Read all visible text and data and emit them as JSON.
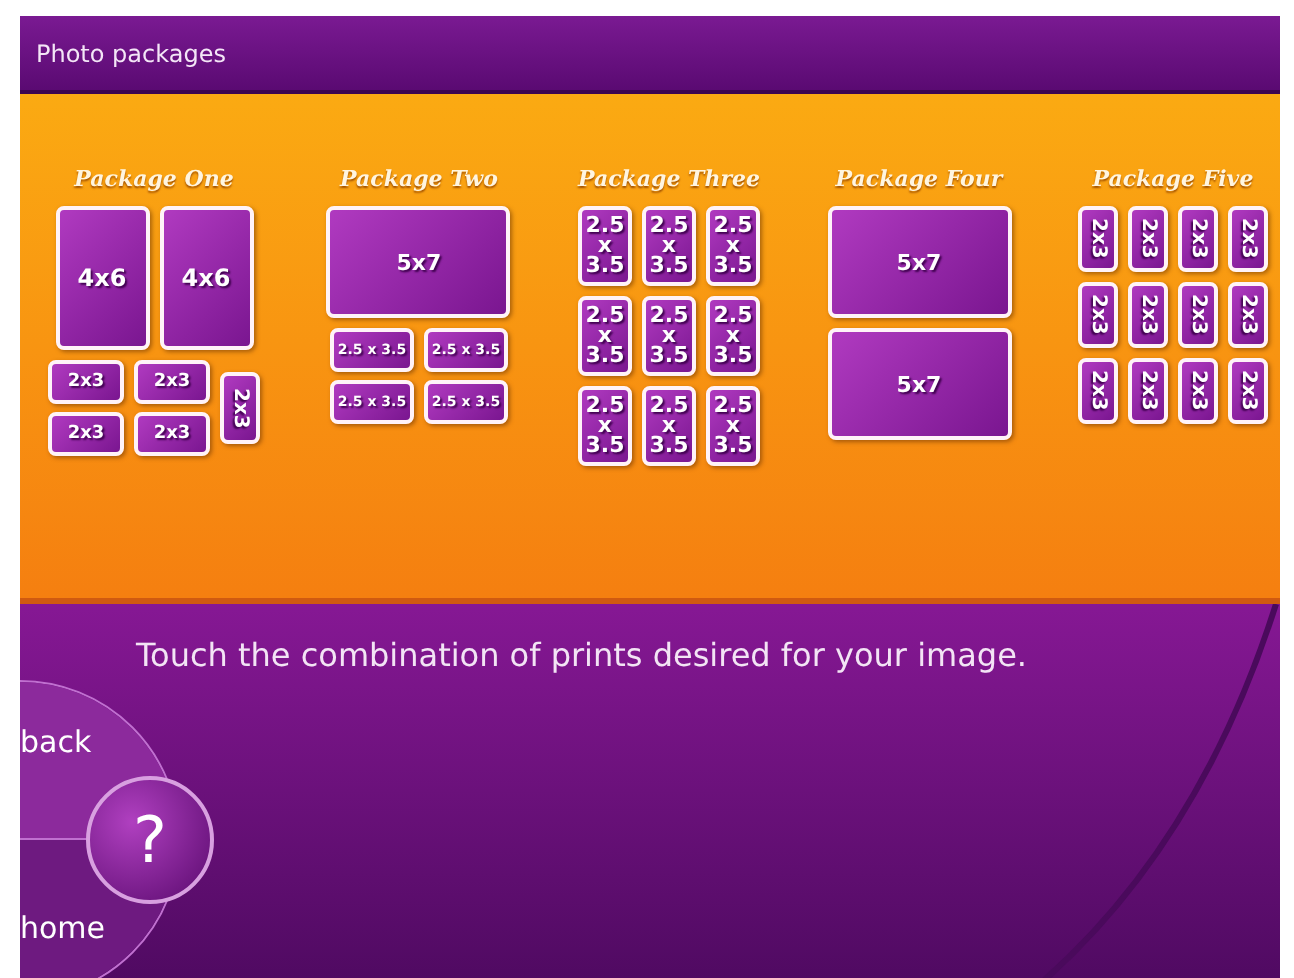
{
  "header": {
    "title": "Photo packages"
  },
  "packages": [
    {
      "title": "Package One",
      "rows": [
        {
          "kind": "line",
          "prints": [
            {
              "label": "4x6",
              "kind": "large-portrait"
            },
            {
              "label": "4x6",
              "kind": "large-portrait"
            }
          ]
        },
        {
          "kind": "pairs",
          "prints": [
            {
              "label": "2x3",
              "kind": "small-landscape"
            },
            {
              "label": "2x3",
              "kind": "small-landscape"
            },
            {
              "label": "2x3",
              "kind": "small-landscape"
            },
            {
              "label": "2x3",
              "kind": "small-landscape"
            },
            {
              "label": "2x3",
              "kind": "rotated-tall"
            }
          ]
        }
      ]
    },
    {
      "title": "Package Two",
      "rows": [
        {
          "kind": "line",
          "prints": [
            {
              "label": "5x7",
              "kind": "large-landscape"
            }
          ]
        },
        {
          "kind": "pairs",
          "prints": [
            {
              "label": "2.5 x 3.5",
              "kind": "small-landscape"
            },
            {
              "label": "2.5 x 3.5",
              "kind": "small-landscape"
            },
            {
              "label": "2.5 x 3.5",
              "kind": "small-landscape"
            },
            {
              "label": "2.5 x 3.5",
              "kind": "small-landscape"
            }
          ]
        }
      ]
    },
    {
      "title": "Package Three",
      "rows": [
        {
          "kind": "line",
          "prints": [
            {
              "label": "2.5 x 3.5",
              "kind": "small-portrait"
            },
            {
              "label": "2.5 x 3.5",
              "kind": "small-portrait"
            },
            {
              "label": "2.5 x 3.5",
              "kind": "small-portrait"
            }
          ]
        },
        {
          "kind": "line",
          "prints": [
            {
              "label": "2.5 x 3.5",
              "kind": "small-portrait"
            },
            {
              "label": "2.5 x 3.5",
              "kind": "small-portrait"
            },
            {
              "label": "2.5 x 3.5",
              "kind": "small-portrait"
            }
          ]
        },
        {
          "kind": "line",
          "prints": [
            {
              "label": "2.5 x 3.5",
              "kind": "small-portrait"
            },
            {
              "label": "2.5 x 3.5",
              "kind": "small-portrait"
            },
            {
              "label": "2.5 x 3.5",
              "kind": "small-portrait"
            }
          ]
        }
      ]
    },
    {
      "title": "Package Four",
      "rows": [
        {
          "kind": "line",
          "prints": [
            {
              "label": "5x7",
              "kind": "large-landscape"
            }
          ]
        },
        {
          "kind": "line",
          "prints": [
            {
              "label": "5x7",
              "kind": "large-landscape"
            }
          ]
        }
      ]
    },
    {
      "title": "Package Five",
      "rows": [
        {
          "kind": "line",
          "prints": [
            {
              "label": "2x3",
              "kind": "rotated"
            },
            {
              "label": "2x3",
              "kind": "rotated"
            },
            {
              "label": "2x3",
              "kind": "rotated"
            },
            {
              "label": "2x3",
              "kind": "rotated"
            }
          ]
        },
        {
          "kind": "line",
          "prints": [
            {
              "label": "2x3",
              "kind": "rotated"
            },
            {
              "label": "2x3",
              "kind": "rotated"
            },
            {
              "label": "2x3",
              "kind": "rotated"
            },
            {
              "label": "2x3",
              "kind": "rotated"
            }
          ]
        },
        {
          "kind": "line",
          "prints": [
            {
              "label": "2x3",
              "kind": "rotated"
            },
            {
              "label": "2x3",
              "kind": "rotated"
            },
            {
              "label": "2x3",
              "kind": "rotated"
            },
            {
              "label": "2x3",
              "kind": "rotated"
            }
          ]
        }
      ]
    }
  ],
  "instruction": "Touch the combination of prints desired for your image.",
  "nav": {
    "back": "back",
    "help": "?",
    "home": "home"
  }
}
